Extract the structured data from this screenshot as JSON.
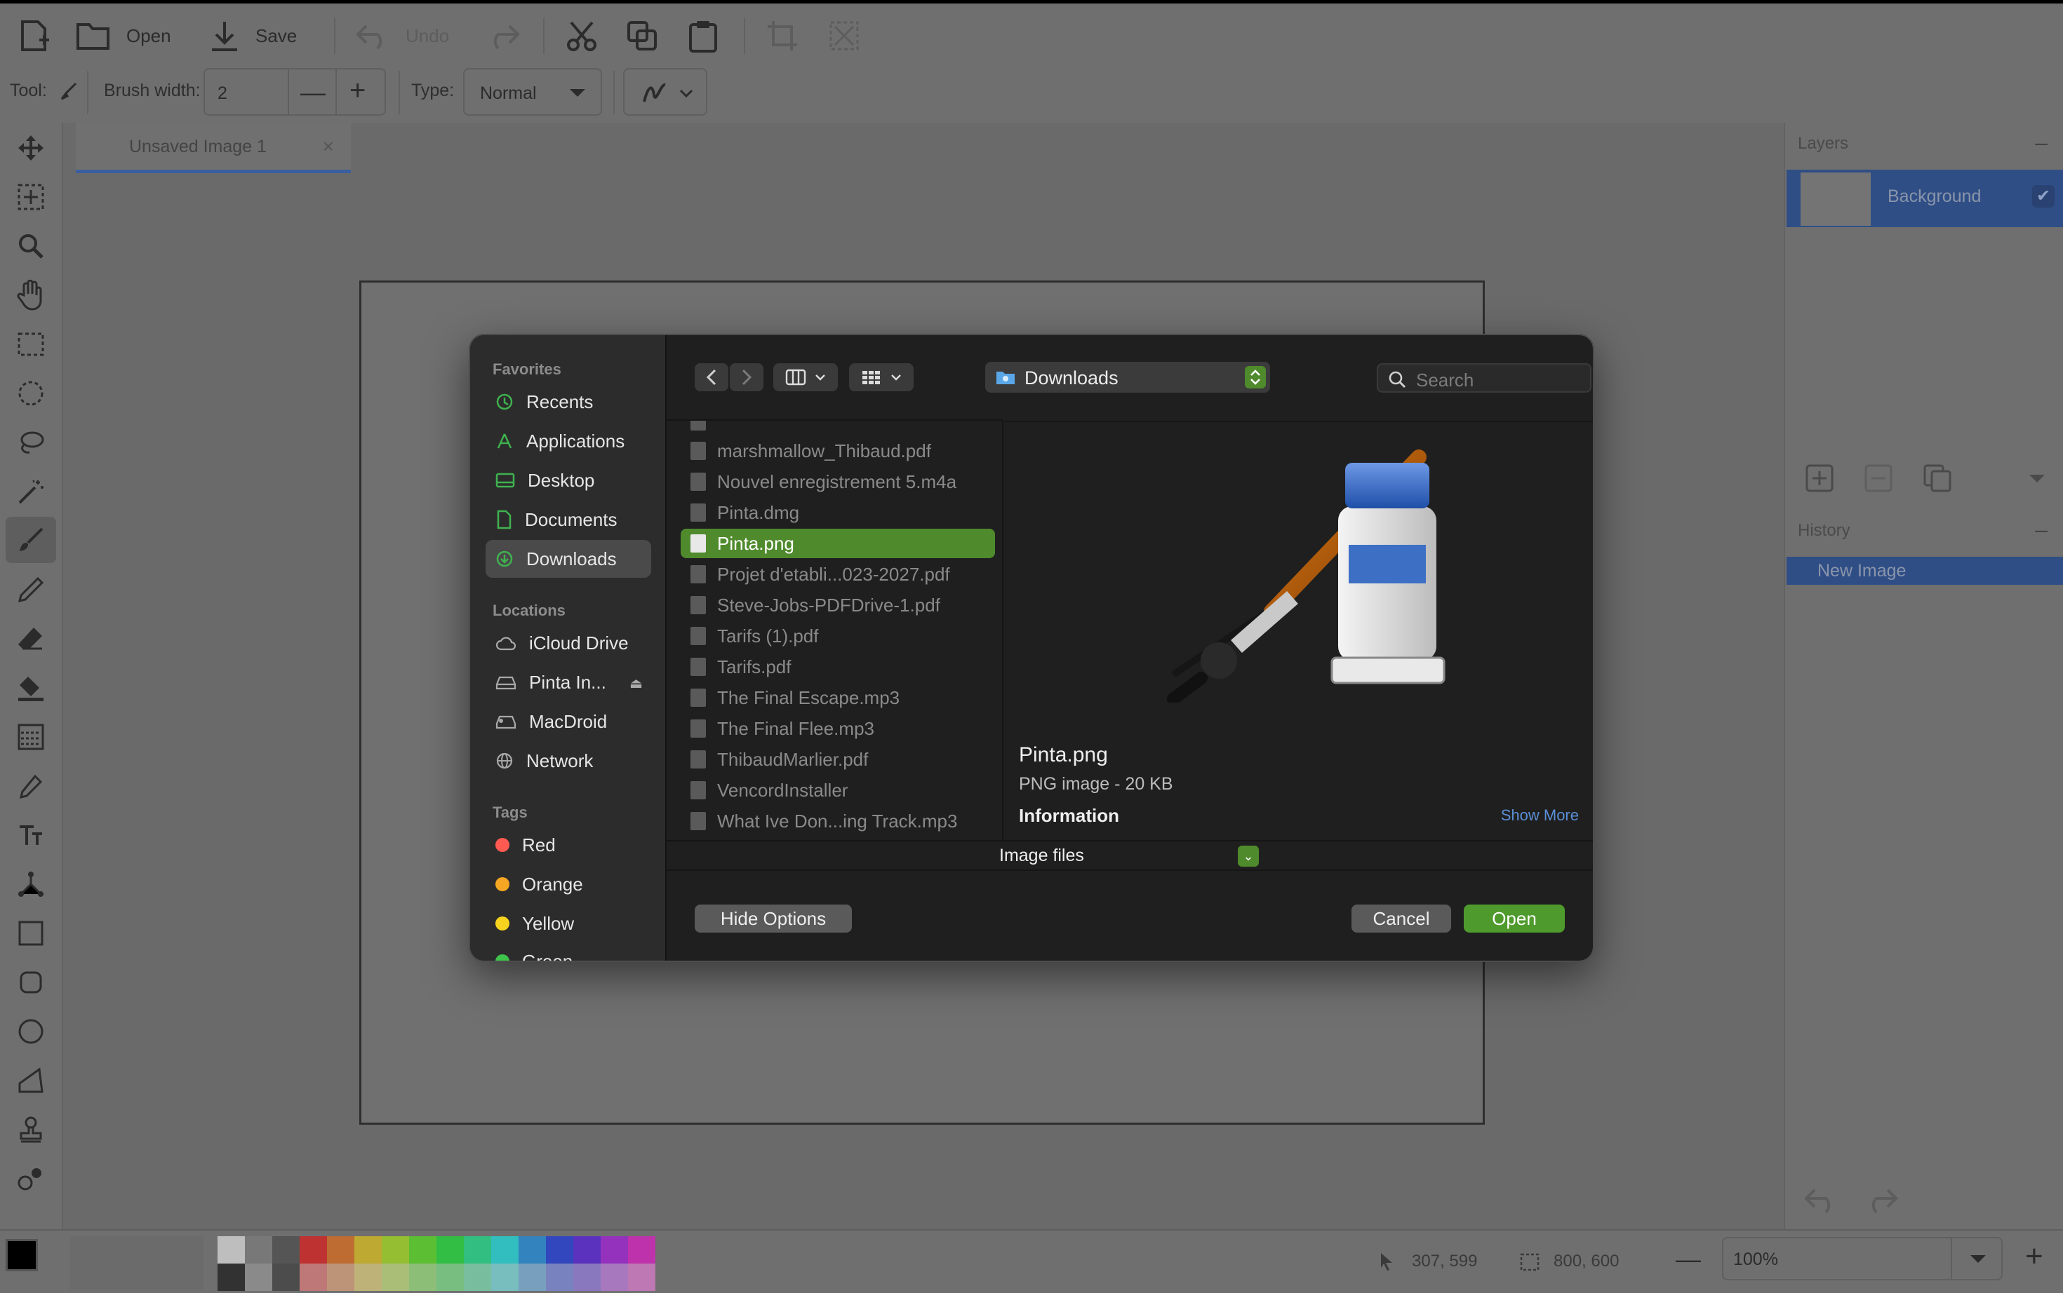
{
  "toolbar": {
    "open_label": "Open",
    "save_label": "Save",
    "undo_label": "Undo"
  },
  "options": {
    "tool_label": "Tool:",
    "brush_width_label": "Brush width:",
    "brush_width_value": "2",
    "type_label": "Type:",
    "type_value": "Normal"
  },
  "document": {
    "tab_title": "Unsaved Image 1"
  },
  "layers_panel": {
    "title": "Layers",
    "layer_name": "Background"
  },
  "history_panel": {
    "title": "History",
    "item": "New Image"
  },
  "status": {
    "cursor_position": "307, 599",
    "selection_size": "800, 600",
    "zoom": "100%"
  },
  "palette": {
    "primary": "#000000",
    "secondary": "#ffffff",
    "top_row": [
      "#ffffff",
      "#808080",
      "#404040",
      "#ff0000",
      "#ff6a00",
      "#ffd800",
      "#b6ff00",
      "#4cff00",
      "#00ff21",
      "#00ff90",
      "#00ffff",
      "#0094ff",
      "#0026ff",
      "#4800ff",
      "#b200ff",
      "#ff00dc"
    ],
    "bottom_row": [
      "#000000",
      "#a0a0a0",
      "#303030",
      "#ff7f7f",
      "#ffb27f",
      "#ffe97f",
      "#daff7f",
      "#a5ff7f",
      "#7fff8e",
      "#7fffc5",
      "#7fffff",
      "#7fc9ff",
      "#7f92ff",
      "#a17fff",
      "#d67fff",
      "#ff7fed"
    ]
  },
  "dialog": {
    "sidebar": {
      "favorites_title": "Favorites",
      "favorites": [
        {
          "label": "Recents",
          "icon": "clock-icon"
        },
        {
          "label": "Applications",
          "icon": "applications-icon"
        },
        {
          "label": "Desktop",
          "icon": "desktop-icon"
        },
        {
          "label": "Documents",
          "icon": "document-icon"
        },
        {
          "label": "Downloads",
          "icon": "download-icon",
          "selected": true
        }
      ],
      "locations_title": "Locations",
      "locations": [
        {
          "label": "iCloud Drive",
          "icon": "cloud-icon"
        },
        {
          "label": "Pinta In...",
          "icon": "disk-icon"
        },
        {
          "label": "MacDroid",
          "icon": "drive-icon"
        },
        {
          "label": "Network",
          "icon": "globe-icon"
        }
      ],
      "tags_title": "Tags",
      "tags": [
        {
          "label": "Red",
          "color": "#ff5a52"
        },
        {
          "label": "Orange",
          "color": "#f6a623"
        },
        {
          "label": "Yellow",
          "color": "#f7d21e"
        },
        {
          "label": "Green",
          "color": "#3fc44b"
        }
      ]
    },
    "location": "Downloads",
    "search_placeholder": "Search",
    "files": [
      {
        "name": "marshmallow_Thibaud.pdf"
      },
      {
        "name": "Nouvel enregistrement 5.m4a"
      },
      {
        "name": "Pinta.dmg"
      },
      {
        "name": "Pinta.png",
        "selected": true
      },
      {
        "name": "Projet d'etabli...023-2027.pdf"
      },
      {
        "name": "Steve-Jobs-PDFDrive-1.pdf"
      },
      {
        "name": "Tarifs (1).pdf"
      },
      {
        "name": "Tarifs.pdf"
      },
      {
        "name": "The Final Escape.mp3"
      },
      {
        "name": "The Final Flee.mp3"
      },
      {
        "name": "ThibaudMarlier.pdf"
      },
      {
        "name": "VencordInstaller"
      },
      {
        "name": "What Ive Don...ing Track.mp3"
      }
    ],
    "preview": {
      "name": "Pinta.png",
      "type": "PNG image - 20 KB",
      "info_title": "Information",
      "show_more": "Show More"
    },
    "filter": "Image files",
    "hide_options": "Hide Options",
    "cancel": "Cancel",
    "open": "Open"
  }
}
